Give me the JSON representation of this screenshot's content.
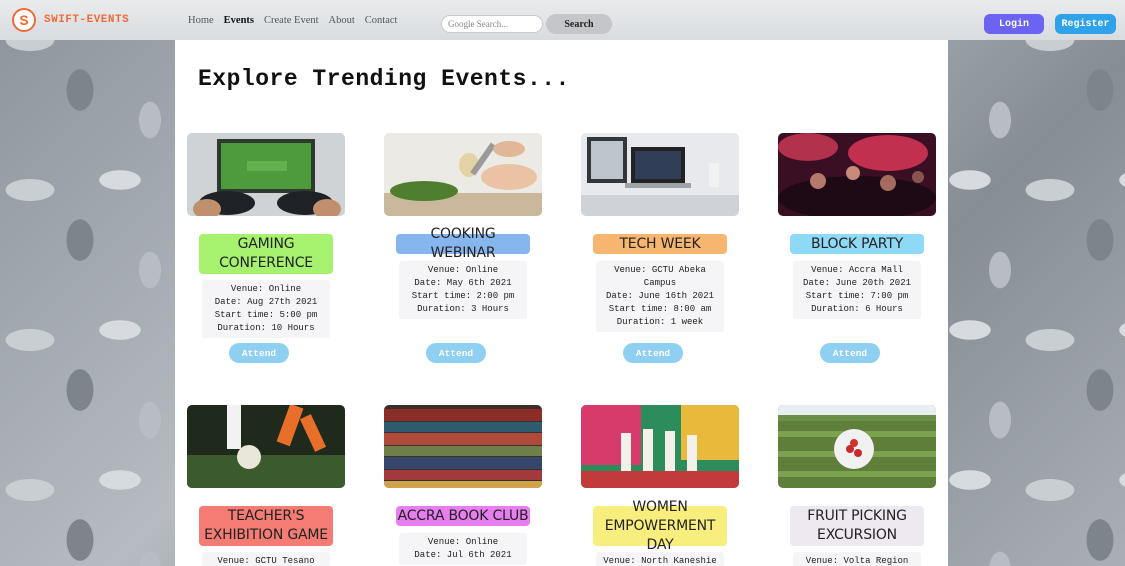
{
  "brand": {
    "logo_letter": "S",
    "name": "SWIFT-EVENTS",
    "color": "#f06a35"
  },
  "nav": {
    "links": [
      "Home",
      "Events",
      "Create Event",
      "About",
      "Contact"
    ],
    "active": "Events"
  },
  "search": {
    "placeholder": "Google Search...",
    "button": "Search"
  },
  "auth": {
    "login": "Login",
    "register": "Register"
  },
  "page_title": "Explore Trending Events...",
  "attend_label": "Attend",
  "events": [
    {
      "title_lines": [
        "GAMING",
        "CONFERENCE"
      ],
      "title_color": "#a6f26f",
      "image": "gaming controllers",
      "info": [
        "Venue: Online",
        "Date: Aug 27th 2021",
        "Start time: 5:00 pm",
        "Duration: 10 Hours"
      ]
    },
    {
      "title_lines": [
        "COOKING WEBINAR"
      ],
      "title_color": "#87b6ee",
      "image": "cooking",
      "info": [
        "Venue: Online",
        "Date: May 6th 2021",
        "Start time: 2:00 pm",
        "Duration: 3 Hours"
      ]
    },
    {
      "title_lines": [
        "TECH WEEK"
      ],
      "title_color": "#f7b670",
      "image": "laptop desk",
      "info": [
        "Venue: GCTU Abeka",
        "Campus",
        "Date: June 16th 2021",
        "Start time: 8:00 am",
        "Duration: 1 week"
      ]
    },
    {
      "title_lines": [
        "BLOCK PARTY"
      ],
      "title_color": "#8ed9f5",
      "image": "concert crowd",
      "info": [
        "Venue: Accra Mall",
        "Date: June 20th 2021",
        "Start time: 7:00 pm",
        "Duration: 6 Hours"
      ]
    },
    {
      "title_lines": [
        "TEACHER'S",
        "EXHIBITION GAME"
      ],
      "title_color": "#f47c75",
      "image": "football",
      "info": [
        "Venue: GCTU Tesano"
      ]
    },
    {
      "title_lines": [
        "ACCRA BOOK CLUB"
      ],
      "title_color": "#e77ef0",
      "image": "books",
      "info": [
        "Venue: Online",
        "Date: Jul 6th 2021"
      ]
    },
    {
      "title_lines": [
        "WOMEN",
        "EMPOWERMENT DAY"
      ],
      "title_color": "#f8ee7e",
      "image": "women group",
      "info": [
        "Venue: North Kaneshie"
      ]
    },
    {
      "title_lines": [
        "FRUIT PICKING",
        "EXCURSION"
      ],
      "title_color": "#eee8f0",
      "image": "strawberries field",
      "info": [
        "Venue: Volta Region"
      ]
    }
  ]
}
